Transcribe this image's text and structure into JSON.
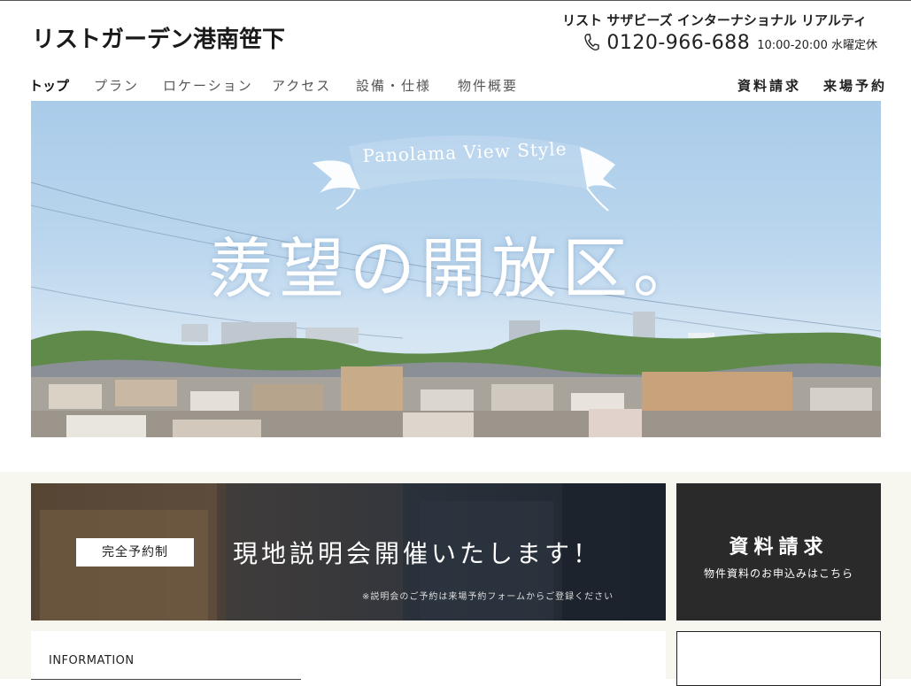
{
  "header": {
    "brand": "リストガーデン港南笹下",
    "company": "リスト サザビーズ インターナショナル リアルティ",
    "phone": "0120-966-688",
    "hours": "10:00-20:00 水曜定休"
  },
  "nav": {
    "items": [
      {
        "label": "トップ"
      },
      {
        "label": "プラン"
      },
      {
        "label": "ロケーション"
      },
      {
        "label": "アクセス"
      },
      {
        "label": "設備・仕様"
      },
      {
        "label": "物件概要"
      }
    ],
    "right": [
      {
        "label": "資料請求"
      },
      {
        "label": "来場予約"
      }
    ]
  },
  "hero": {
    "ribbon": "Panolama View Style",
    "headline": "羨望の開放区。"
  },
  "event": {
    "badge": "完全予約制",
    "title": "現地説明会開催いたします！",
    "note": "※説明会のご予約は来場予約フォームからご登録ください"
  },
  "document_request": {
    "title": "資料請求",
    "subtitle": "物件資料のお申込みはこちら"
  },
  "information": {
    "title": "INFORMATION"
  },
  "colors": {
    "dark_panel": "#2a2a2a",
    "sky": "#a9cbe9",
    "lower_bg": "#f7f7ef"
  }
}
